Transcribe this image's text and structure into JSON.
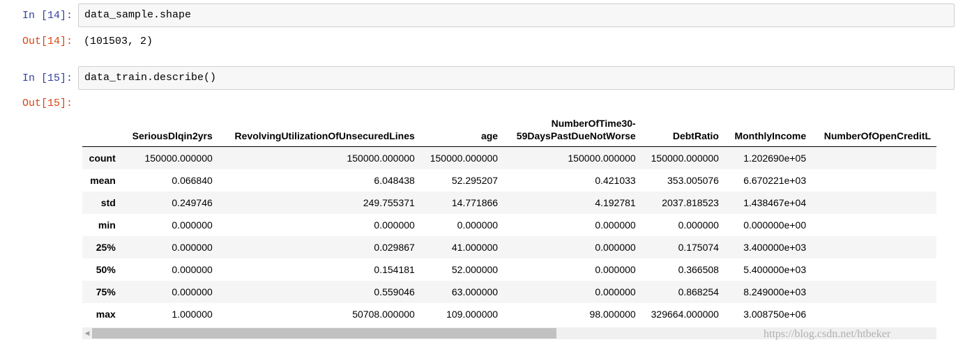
{
  "cells": [
    {
      "in_prompt": "In [14]:",
      "code": "data_sample.shape",
      "out_prompt": "Out[14]:",
      "output": "(101503, 2)"
    },
    {
      "in_prompt": "In [15]:",
      "code": "data_train.describe()",
      "out_prompt": "Out[15]:"
    }
  ],
  "dataframe": {
    "columns": [
      "",
      "SeriousDlqin2yrs",
      "RevolvingUtilizationOfUnsecuredLines",
      "age",
      [
        "NumberOfTime30-",
        "59DaysPastDueNotWorse"
      ],
      "DebtRatio",
      "MonthlyIncome",
      "NumberOfOpenCreditL"
    ],
    "rows": [
      {
        "label": "count",
        "values": [
          "150000.000000",
          "150000.000000",
          "150000.000000",
          "150000.000000",
          "150000.000000",
          "1.202690e+05",
          ""
        ]
      },
      {
        "label": "mean",
        "values": [
          "0.066840",
          "6.048438",
          "52.295207",
          "0.421033",
          "353.005076",
          "6.670221e+03",
          ""
        ]
      },
      {
        "label": "std",
        "values": [
          "0.249746",
          "249.755371",
          "14.771866",
          "4.192781",
          "2037.818523",
          "1.438467e+04",
          ""
        ]
      },
      {
        "label": "min",
        "values": [
          "0.000000",
          "0.000000",
          "0.000000",
          "0.000000",
          "0.000000",
          "0.000000e+00",
          ""
        ]
      },
      {
        "label": "25%",
        "values": [
          "0.000000",
          "0.029867",
          "41.000000",
          "0.000000",
          "0.175074",
          "3.400000e+03",
          ""
        ]
      },
      {
        "label": "50%",
        "values": [
          "0.000000",
          "0.154181",
          "52.000000",
          "0.000000",
          "0.366508",
          "5.400000e+03",
          ""
        ]
      },
      {
        "label": "75%",
        "values": [
          "0.000000",
          "0.559046",
          "63.000000",
          "0.000000",
          "0.868254",
          "8.249000e+03",
          ""
        ]
      },
      {
        "label": "max",
        "values": [
          "1.000000",
          "50708.000000",
          "109.000000",
          "98.000000",
          "329664.000000",
          "3.008750e+06",
          ""
        ]
      }
    ]
  },
  "scrollbar": {
    "left_arrow": "◀",
    "position": 0.0,
    "visible_fraction": 0.55
  },
  "watermark": "https://blog.csdn.net/htbeker"
}
